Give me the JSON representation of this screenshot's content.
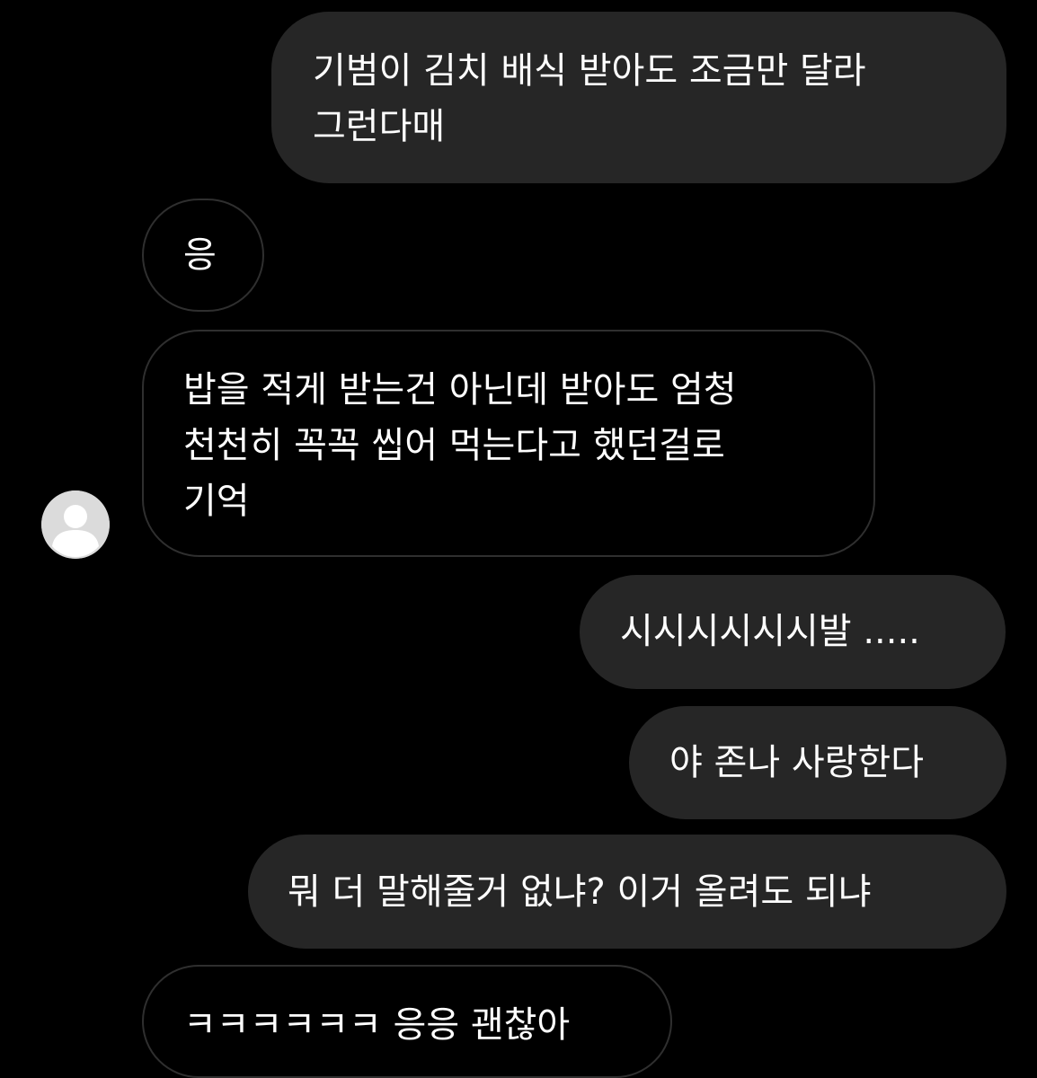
{
  "conversation": {
    "messages": [
      {
        "sender": "me",
        "text": "기범이 김치 배식 받아도 조금만 달라\n그런다매"
      },
      {
        "sender": "other",
        "text": "응"
      },
      {
        "sender": "other",
        "text": "밥을 적게 받는건 아닌데 받아도 엄청\n천천히 꼭꼭 씹어 먹는다고 했던걸로\n기억"
      },
      {
        "sender": "me",
        "text": "시시시시시시발 ....."
      },
      {
        "sender": "me",
        "text": "야 존나 사랑한다"
      },
      {
        "sender": "me",
        "text": "뭐 더 말해줄거 없냐? 이거 올려도 되냐"
      },
      {
        "sender": "other",
        "text": "ㅋㅋㅋㅋㅋㅋ 응응 괜찮아"
      }
    ]
  },
  "avatar": {
    "icon": "default-profile-icon"
  },
  "colors": {
    "background": "#000000",
    "sent_bubble": "#262626",
    "received_border": "#2f2f2f",
    "text": "#ffffff",
    "avatar": "#dbdbdb"
  }
}
